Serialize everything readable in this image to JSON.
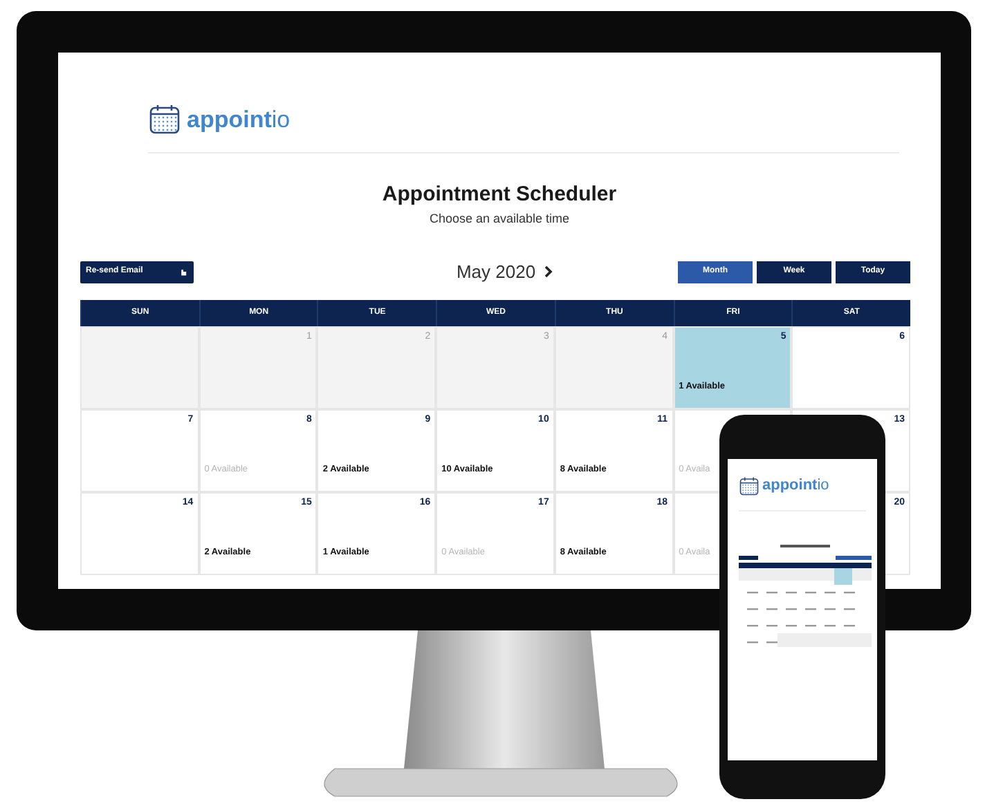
{
  "logo": {
    "text": "**appoint**io"
  },
  "title": "Appointment Scheduler",
  "subtitle": "Choose an available time",
  "resend_button": {
    "label": "Re-send Email"
  },
  "month_label": "May 2020",
  "views": [
    {
      "label": "Month",
      "selected": true
    },
    {
      "label": "Week",
      "selected": false
    },
    {
      "label": "Today",
      "selected": false
    }
  ],
  "weekdays": [
    "SUN",
    "MON",
    "TUE",
    "WED",
    "THU",
    "FRI",
    "SAT"
  ],
  "weeks": [
    [
      {
        "past": true,
        "selected": false
      },
      {
        "day": "1",
        "past": true,
        "selected": false
      },
      {
        "day": "2",
        "past": true,
        "selected": false
      },
      {
        "day": "3",
        "past": true,
        "selected": false
      },
      {
        "day": "4",
        "past": true,
        "selected": false
      },
      {
        "day": "5",
        "past": false,
        "selected": true,
        "available": "1 Available",
        "has_slots": true
      },
      {
        "day": "6",
        "past": false,
        "selected": false
      }
    ],
    [
      {
        "day": "7",
        "past": false,
        "selected": false
      },
      {
        "day": "8",
        "past": false,
        "selected": false,
        "available": "0 Available",
        "has_slots": false
      },
      {
        "day": "9",
        "past": false,
        "selected": false,
        "available": "2 Available",
        "has_slots": true
      },
      {
        "day": "10",
        "past": false,
        "selected": false,
        "available": "10 Available",
        "has_slots": true
      },
      {
        "day": "11",
        "past": false,
        "selected": false,
        "available": "8 Available",
        "has_slots": true
      },
      {
        "past": false,
        "selected": false,
        "available": "0 Availa",
        "has_slots": false
      },
      {
        "day": "13",
        "past": false,
        "selected": false
      }
    ],
    [
      {
        "day": "14",
        "past": false,
        "selected": false
      },
      {
        "day": "15",
        "past": false,
        "selected": false,
        "available": "2 Available",
        "has_slots": true
      },
      {
        "day": "16",
        "past": false,
        "selected": false,
        "available": "1 Available",
        "has_slots": true
      },
      {
        "day": "17",
        "past": false,
        "selected": false,
        "available": "0 Available",
        "has_slots": false
      },
      {
        "day": "18",
        "past": false,
        "selected": false,
        "available": "8 Available",
        "has_slots": true
      },
      {
        "past": false,
        "selected": false,
        "available": "0 Availa",
        "has_slots": false
      },
      {
        "day": "20",
        "past": false,
        "selected": false
      }
    ]
  ],
  "phone": {
    "logo": "**appoint**io"
  }
}
